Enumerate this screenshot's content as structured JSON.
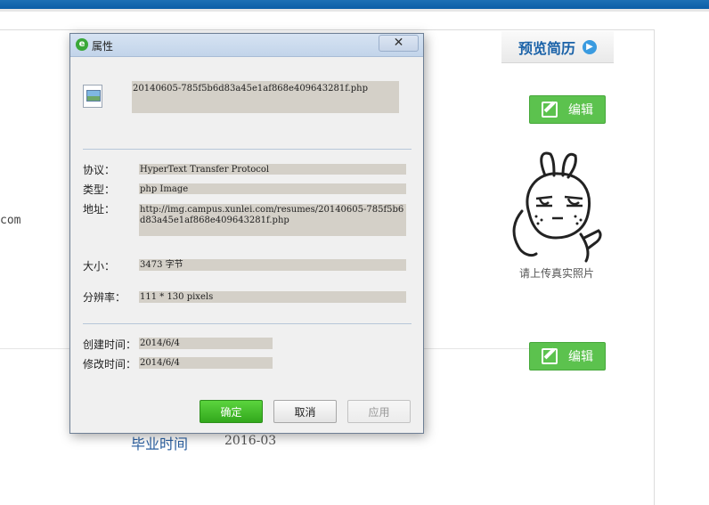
{
  "page": {
    "clipped_text": "com",
    "preview_button": "预览简历",
    "edit_button_1": "编辑",
    "edit_button_2": "编辑",
    "avatar_caption": "请上传真实照片",
    "graduation_label": "毕业时间",
    "graduation_value": "2016-03"
  },
  "dialog": {
    "title": "属性",
    "close_glyph": "✕",
    "filename": "20140605-785f5b6d83a45e1af868e409643281f.php",
    "protocol_label": "协议：",
    "protocol_value": "HyperText Transfer Protocol",
    "type_label": "类型：",
    "type_value": "php Image",
    "address_label": "地址：",
    "address_value": "http://img.campus.xunlei.com/resumes/20140605-785f5b6d83a45e1af868e409643281f.php",
    "size_label": "大小：",
    "size_value": "3473 字节",
    "resolution_label": "分辨率：",
    "resolution_value": "111 * 130 pixels",
    "created_label": "创建时间：",
    "created_value": "2014/6/4",
    "modified_label": "修改时间：",
    "modified_value": "2014/6/4",
    "ok_button": "确定",
    "cancel_button": "取消",
    "apply_button": "应用"
  },
  "colors": {
    "accent_blue": "#0b5ea7",
    "edit_green": "#5cc24e",
    "ok_green": "#32a81c",
    "field_gray": "#d4d0c8"
  },
  "icons": [
    "ie-browser-icon",
    "close-icon",
    "image-file-icon",
    "edit-icon",
    "arrow-right-icon"
  ]
}
